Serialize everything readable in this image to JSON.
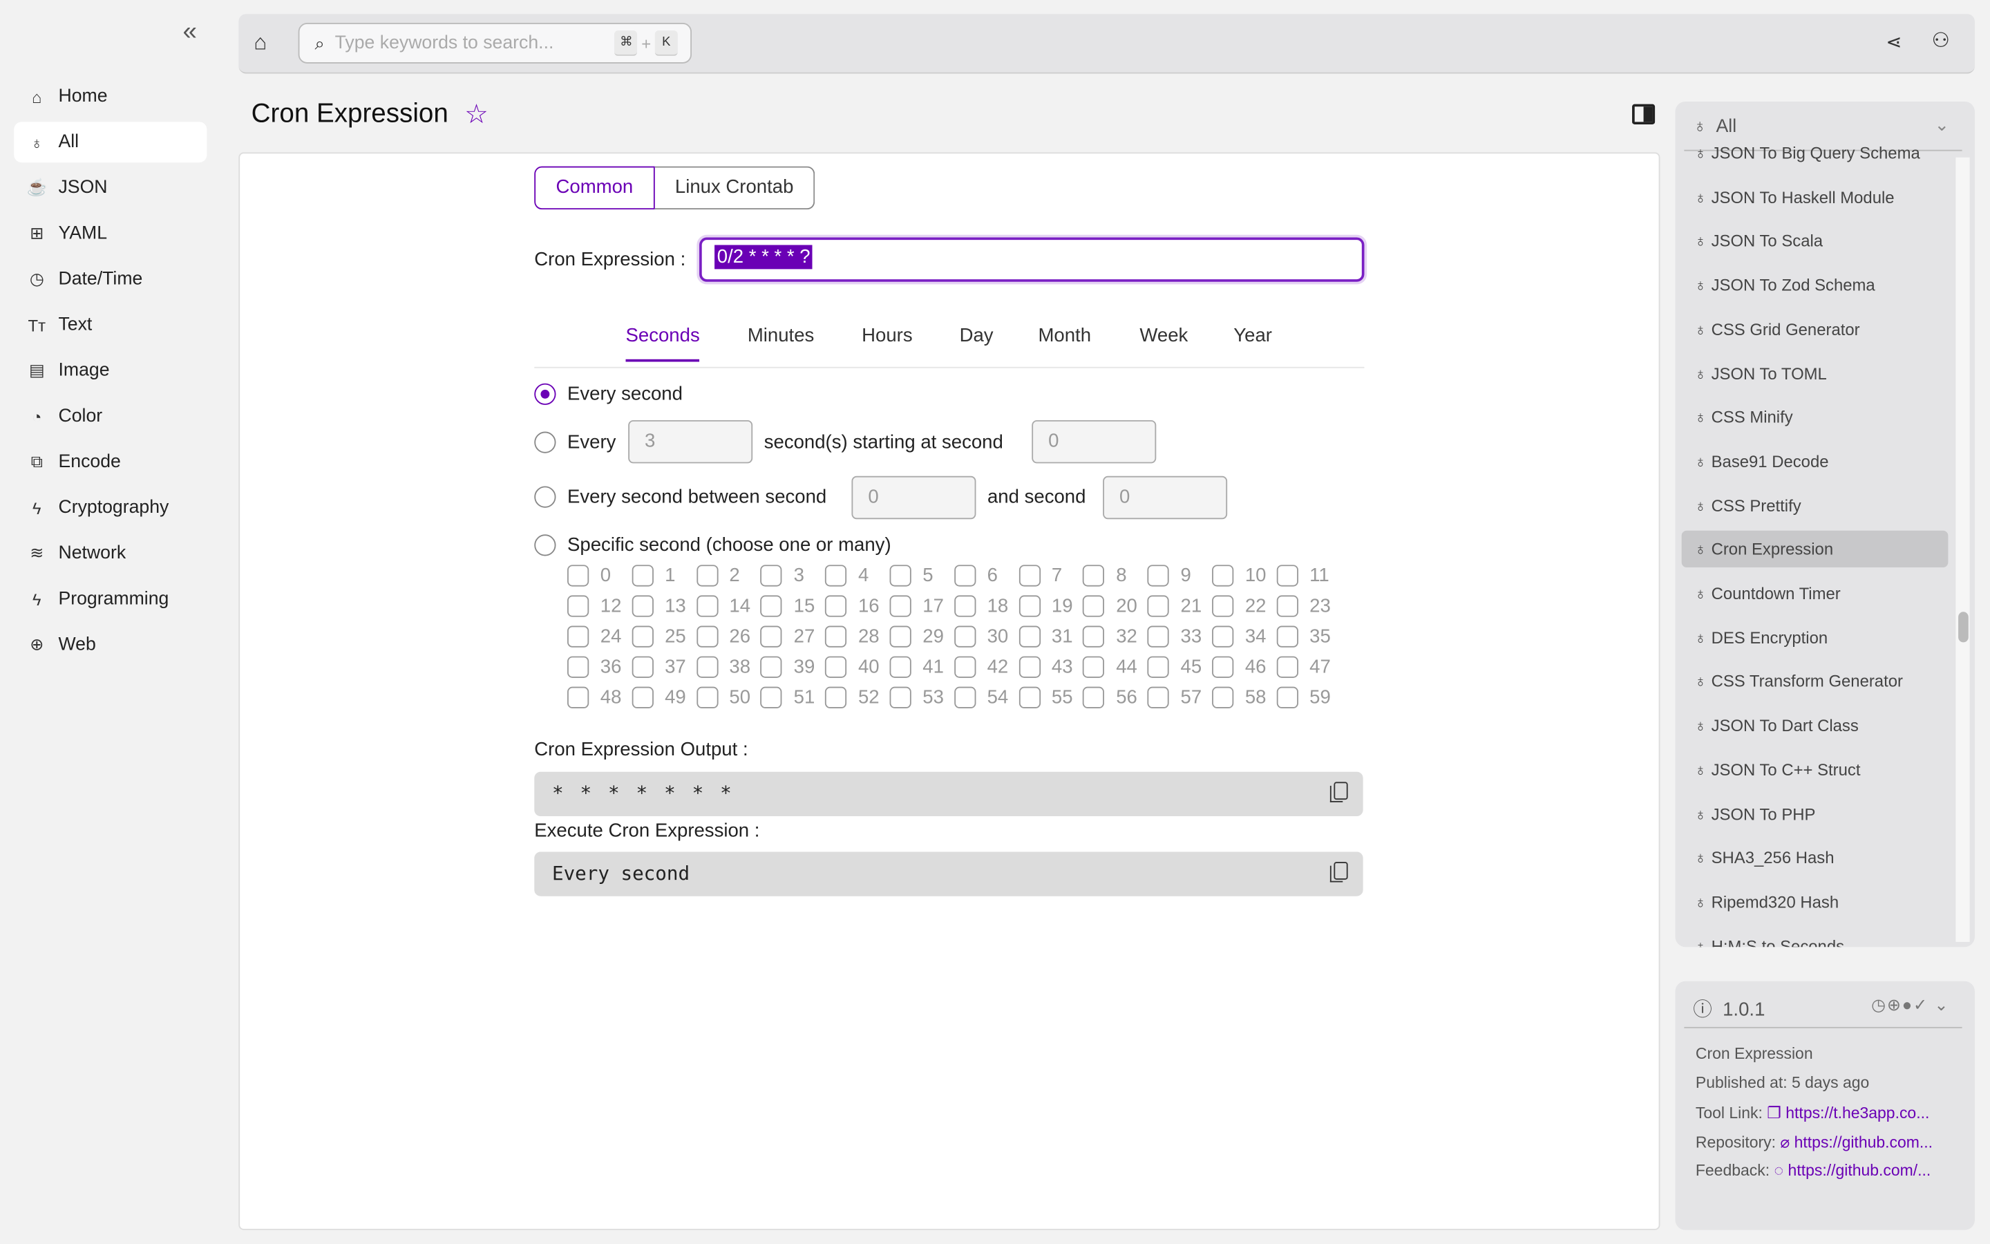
{
  "sidebar": {
    "collapse_icon": "double-chevron-left",
    "items": [
      {
        "label": "Home",
        "icon": "⌂",
        "active": false
      },
      {
        "label": "All",
        "icon": "♁",
        "active": true
      },
      {
        "label": "JSON",
        "icon": "☕",
        "active": false
      },
      {
        "label": "YAML",
        "icon": "⊞",
        "active": false
      },
      {
        "label": "Date/Time",
        "icon": "◷",
        "active": false
      },
      {
        "label": "Text",
        "icon": "Tт",
        "active": false
      },
      {
        "label": "Image",
        "icon": "▤",
        "active": false
      },
      {
        "label": "Color",
        "icon": "◔",
        "active": false
      },
      {
        "label": "Encode",
        "icon": "⧉",
        "active": false
      },
      {
        "label": "Cryptography",
        "icon": "ϟ",
        "active": false
      },
      {
        "label": "Network",
        "icon": "≋",
        "active": false
      },
      {
        "label": "Programming",
        "icon": "ϟ",
        "active": false
      },
      {
        "label": "Web",
        "icon": "⊕",
        "active": false
      }
    ]
  },
  "topbar": {
    "search_placeholder": "Type keywords to search...",
    "shortcut_key1": "⌘",
    "shortcut_plus": "+",
    "shortcut_key2": "K"
  },
  "page": {
    "title": "Cron Expression"
  },
  "mode_tabs": {
    "common": "Common",
    "linux": "Linux Crontab"
  },
  "cron": {
    "label": "Cron Expression :",
    "value": "0/2 * * * * ?"
  },
  "unit_tabs": [
    {
      "label": "Seconds",
      "active": true
    },
    {
      "label": "Minutes"
    },
    {
      "label": "Hours"
    },
    {
      "label": "Day"
    },
    {
      "label": "Month"
    },
    {
      "label": "Week"
    },
    {
      "label": "Year"
    }
  ],
  "options": {
    "every_second": "Every second",
    "every": "Every",
    "every_value": "3",
    "starting_at": "second(s) starting at second",
    "start_value": "0",
    "between": "Every second between second",
    "between_from": "0",
    "and_second": "and second",
    "between_to": "0",
    "specific": "Specific second (choose one or many)",
    "selected": "every_second"
  },
  "second_options": [
    "0",
    "1",
    "2",
    "3",
    "4",
    "5",
    "6",
    "7",
    "8",
    "9",
    "10",
    "11",
    "12",
    "13",
    "14",
    "15",
    "16",
    "17",
    "18",
    "19",
    "20",
    "21",
    "22",
    "23",
    "24",
    "25",
    "26",
    "27",
    "28",
    "29",
    "30",
    "31",
    "32",
    "33",
    "34",
    "35",
    "36",
    "37",
    "38",
    "39",
    "40",
    "41",
    "42",
    "43",
    "44",
    "45",
    "46",
    "47",
    "48",
    "49",
    "50",
    "51",
    "52",
    "53",
    "54",
    "55",
    "56",
    "57",
    "58",
    "59"
  ],
  "output": {
    "label": "Cron Expression Output :",
    "value": "* * * * * * *",
    "execute_label": "Execute Cron Expression :",
    "execute_value": "Every second"
  },
  "tool_list": {
    "filter": "All",
    "items": [
      "JSON To Big Query Schema",
      "JSON To Haskell Module",
      "JSON To Scala",
      "JSON To Zod Schema",
      "CSS Grid Generator",
      "JSON To TOML",
      "CSS Minify",
      "Base91 Decode",
      "CSS Prettify",
      "Cron Expression",
      "Countdown Timer",
      "DES Encryption",
      "CSS Transform Generator",
      "JSON To Dart Class",
      "JSON To C++ Struct",
      "JSON To PHP",
      "SHA3_256 Hash",
      "Ripemd320 Hash",
      "H:M:S to Seconds"
    ],
    "active": "Cron Expression"
  },
  "info": {
    "version": "1.0.1",
    "name": "Cron Expression",
    "published": "Published at: 5 days ago",
    "tool_link_label": "Tool Link:",
    "tool_link": "https://t.he3app.co...",
    "repo_label": "Repository:",
    "repo_link": "https://github.com...",
    "feedback_label": "Feedback:",
    "feedback_link": "https://github.com/..."
  },
  "colors": {
    "accent": "#6a00b5",
    "background": "#f2f2f2",
    "panel": "#e4e4e6"
  }
}
